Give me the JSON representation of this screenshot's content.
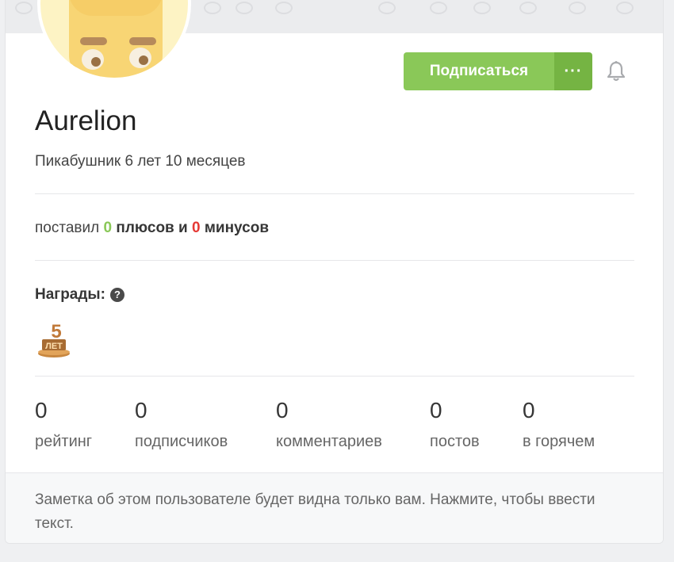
{
  "profile": {
    "username": "Aurelion",
    "tenure": "Пикабушник 6 лет 10 месяцев",
    "avatar_icon": "cheese-character-avatar"
  },
  "actions": {
    "subscribe_label": "Подписаться",
    "more_label": "···",
    "bell_icon": "bell-icon"
  },
  "votes": {
    "prefix": "поставил",
    "plus_count": "0",
    "plus_label": "плюсов и",
    "minus_count": "0",
    "minus_label": "минусов"
  },
  "awards": {
    "title": "Награды:",
    "help_icon": "question-circle-icon",
    "items": [
      {
        "icon": "5-years-trophy-icon",
        "text": "5 ЛЕТ"
      }
    ]
  },
  "stats": [
    {
      "value": "0",
      "label": "рейтинг"
    },
    {
      "value": "0",
      "label": "подписчиков"
    },
    {
      "value": "0",
      "label": "комментариев"
    },
    {
      "value": "0",
      "label": "постов"
    },
    {
      "value": "0",
      "label": "в горячем"
    }
  ],
  "note": {
    "text": "Заметка об этом пользователе будет видна только вам. Нажмите, чтобы ввести текст."
  },
  "colors": {
    "accent_green": "#8ac858",
    "accent_green_dark": "#75b443",
    "minus_red": "#e53935"
  }
}
